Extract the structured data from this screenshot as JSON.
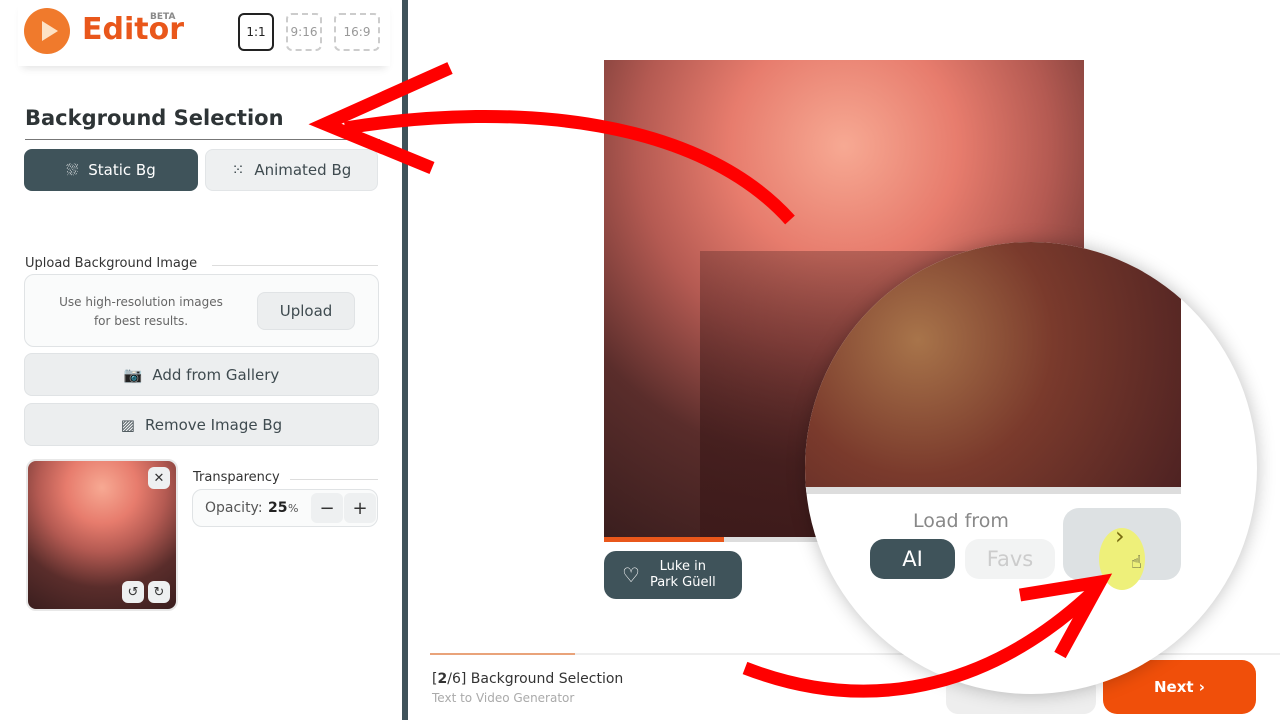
{
  "header": {
    "brand": "Editor",
    "badge": "BETA",
    "ratios": [
      {
        "label": "1:1",
        "active": true
      },
      {
        "label": "9:16",
        "active": false
      },
      {
        "label": "16:9",
        "active": false
      }
    ]
  },
  "sidebar": {
    "title": "Background Selection",
    "tabs": [
      {
        "label": "Static Bg",
        "active": true,
        "icon": "static-grid-icon"
      },
      {
        "label": "Animated Bg",
        "active": false,
        "icon": "dots-grid-icon"
      }
    ],
    "upload": {
      "label": "Upload Background Image",
      "hint": "Use high-resolution images for best results.",
      "button": "Upload"
    },
    "gallery_button": "Add from Gallery",
    "remove_bg_button": "Remove Image Bg",
    "transparency": {
      "label": "Transparency",
      "opacity_label": "Opacity:",
      "opacity_value": "25",
      "unit": "%",
      "minus": "−",
      "plus": "+"
    }
  },
  "preview": {
    "progress_percent": 25,
    "chip_label_line1": "Luke in",
    "chip_label_line2": "Park Güell"
  },
  "magnifier": {
    "load_from_label": "Load from",
    "options": [
      {
        "label": "AI",
        "active": true
      },
      {
        "label": "Favs",
        "active": false
      }
    ],
    "next_arrow": "›"
  },
  "footer": {
    "step_current": "2",
    "step_total": "6",
    "step_title": "Background Selection",
    "subtitle": "Text to Video Generator",
    "next_button": "Next ›",
    "progress_percent": 17
  },
  "colors": {
    "accent": "#e9571b",
    "primary_dark": "#3f535a",
    "annotation_red": "#ff0000",
    "highlight": "#eef07a"
  }
}
